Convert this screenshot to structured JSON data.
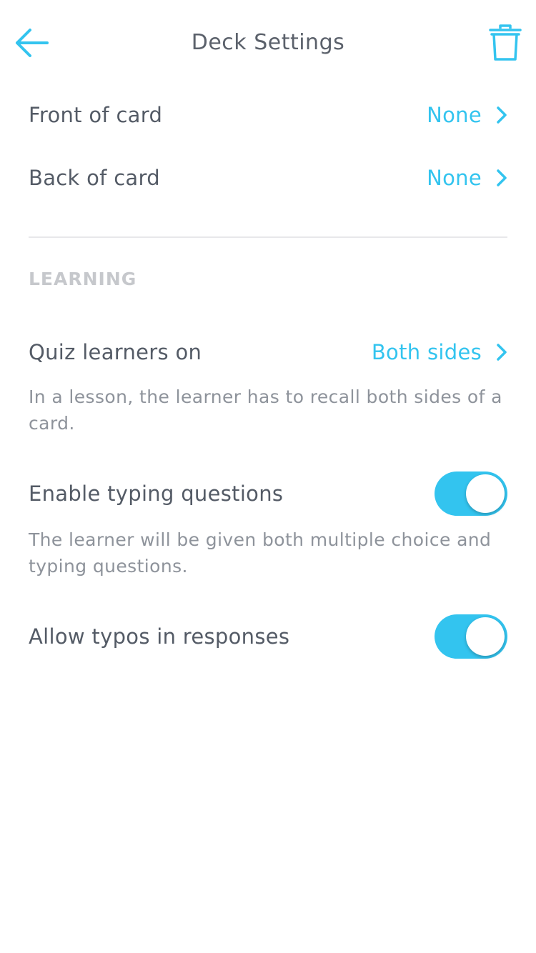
{
  "header": {
    "title": "Deck Settings",
    "back_icon": "arrow-left-icon",
    "delete_icon": "trash-icon"
  },
  "card_display": {
    "front": {
      "label": "Front of card",
      "value": "None"
    },
    "back": {
      "label": "Back of card",
      "value": "None"
    }
  },
  "learning": {
    "section_title": "LEARNING",
    "quiz": {
      "label": "Quiz learners on",
      "value": "Both sides",
      "description": "In a lesson, the learner has to recall both sides of a card."
    },
    "typing": {
      "label": "Enable typing questions",
      "enabled": true,
      "description": "The learner will be given both multiple choice and typing questions."
    },
    "typos": {
      "label": "Allow typos in responses",
      "enabled": true
    }
  },
  "colors": {
    "accent": "#33c4ef",
    "text": "#545b66",
    "muted": "#8e939b",
    "section": "#c6c8cc"
  }
}
